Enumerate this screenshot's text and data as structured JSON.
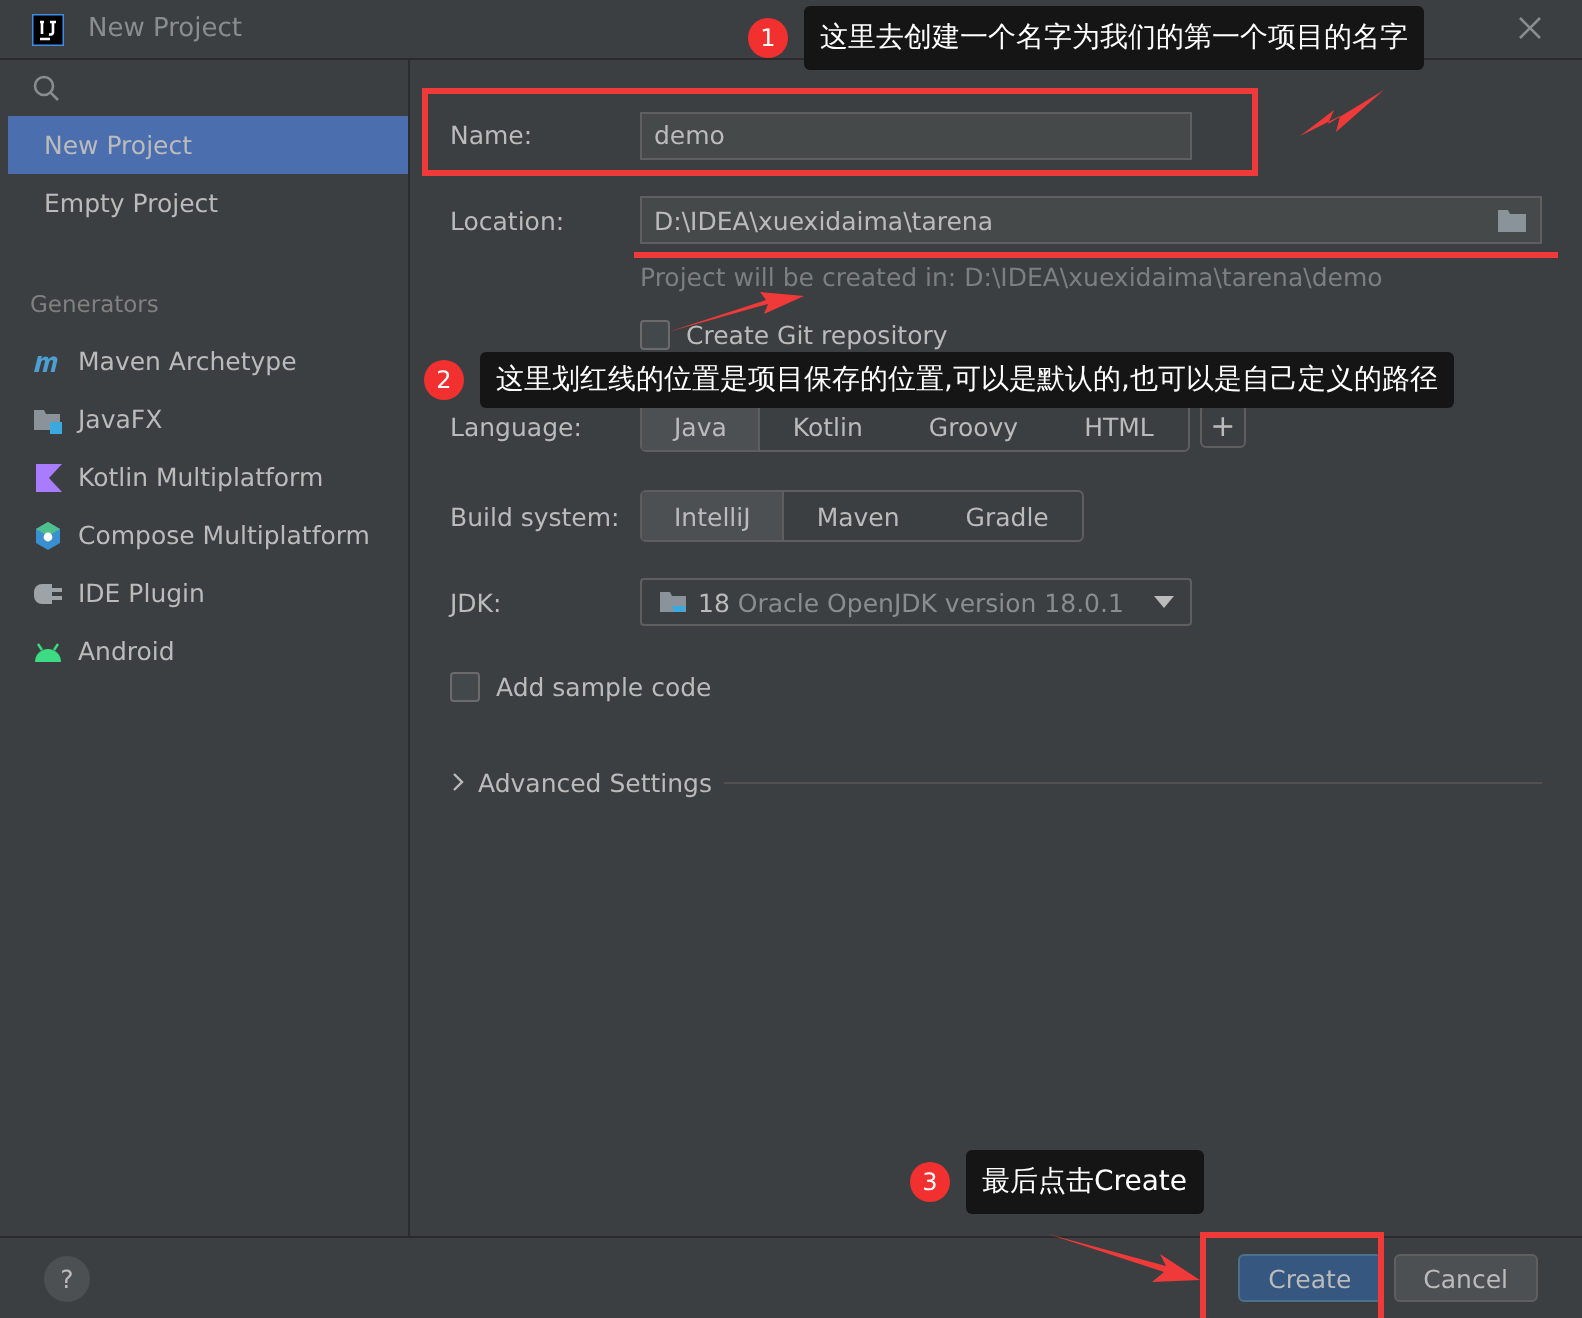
{
  "window": {
    "title": "New Project"
  },
  "sidebar": {
    "items": [
      {
        "label": "New Project",
        "selected": true
      },
      {
        "label": "Empty Project",
        "selected": false
      }
    ],
    "section": "Generators",
    "generators": [
      {
        "label": "Maven Archetype",
        "kind": "maven"
      },
      {
        "label": "JavaFX",
        "kind": "javafx"
      },
      {
        "label": "Kotlin Multiplatform",
        "kind": "kotlin"
      },
      {
        "label": "Compose Multiplatform",
        "kind": "compose"
      },
      {
        "label": "IDE Plugin",
        "kind": "plugin"
      },
      {
        "label": "Android",
        "kind": "android"
      }
    ]
  },
  "form": {
    "name": {
      "label": "Name:",
      "value": "demo"
    },
    "location": {
      "label": "Location:",
      "value": "D:\\IDEA\\xuexidaima\\tarena",
      "hint": "Project will be created in: D:\\IDEA\\xuexidaima\\tarena\\demo"
    },
    "git": {
      "label": "Create Git repository",
      "checked": false
    },
    "language": {
      "label": "Language:",
      "options": [
        {
          "label": "Java",
          "selected": true
        },
        {
          "label": "Kotlin",
          "selected": false
        },
        {
          "label": "Groovy",
          "selected": false
        },
        {
          "label": "HTML",
          "selected": false
        }
      ],
      "add": "+"
    },
    "build": {
      "label": "Build system:",
      "options": [
        {
          "label": "IntelliJ",
          "selected": true
        },
        {
          "label": "Maven",
          "selected": false
        },
        {
          "label": "Gradle",
          "selected": false
        }
      ]
    },
    "jdk": {
      "label": "JDK:",
      "version": "18",
      "description": "Oracle OpenJDK version 18.0.1"
    },
    "sample": {
      "label": "Add sample code",
      "checked": false
    },
    "advanced": {
      "label": "Advanced Settings",
      "expanded": false
    }
  },
  "footer": {
    "help": "?",
    "buttons": [
      {
        "label": "Create",
        "kind": "primary"
      },
      {
        "label": "Cancel",
        "kind": "secondary"
      }
    ]
  },
  "annotations": [
    {
      "number": "1",
      "text": "这里去创建一个名字为我们的第一个项目的名字"
    },
    {
      "number": "2",
      "text": "这里划红线的位置是项目保存的位置,可以是默认的,也可以是自己定义的路径"
    },
    {
      "number": "3",
      "text": "最后点击Create"
    }
  ]
}
